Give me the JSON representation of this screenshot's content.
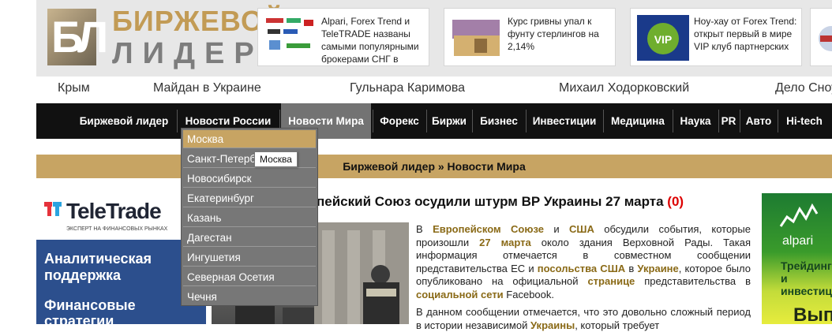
{
  "logo": {
    "line1": "БИРЖЕВОЙ",
    "line2": "ЛИДЕР",
    "mark": "БЛ"
  },
  "header_news": [
    {
      "text": "Alpari, Forex Trend и TeleTRADE названы самыми популярными брокерами СНГ в",
      "thumb_icon": "forex-brokers-thumb"
    },
    {
      "text": "Курс гривны упал к фунту стерлингов на 2,14%",
      "thumb_icon": "banknotes-thumb"
    },
    {
      "text": "Hoy-хау от Forex Trend: открыт первый в мире VIP клуб партнерских",
      "thumb_icon": "vip-badge-thumb"
    }
  ],
  "tags": [
    "Крым",
    "Майдан в Украине",
    "Гульнара Каримова",
    "Михаил Ходорковский",
    "Дело Сноудена"
  ],
  "nav": {
    "items": [
      "Биржевой лидер",
      "Новости России",
      "Новости Мира",
      "Форекс",
      "Биржи",
      "Бизнес",
      "Инвестиции",
      "Медицина",
      "Наука",
      "PR",
      "Авто",
      "Hi-tech"
    ],
    "active": "Новости Мира"
  },
  "breadcrumb": "Биржевой лидер » Новости Мира",
  "dropdown": {
    "items": [
      "Москва",
      "Санкт-Петербург",
      "Новосибирск",
      "Екатеринбург",
      "Казань",
      "Дагестан",
      "Ингушетия",
      "Северная Осетия",
      "Чечня"
    ],
    "hovered": "Москва",
    "tooltip": "Москва"
  },
  "left_ad": {
    "brand": "TeleTrade",
    "tagline": "ЭКСПЕРТ НА ФИНАНСОВЫХ РЫНКАХ",
    "line1": "Аналитическая",
    "line2": "поддержка",
    "line3": "Финансовые",
    "line4": "стратегии"
  },
  "article": {
    "title": "пейский Союз осудили штурм ВР Украины 27 марта",
    "comment_count": "(0)",
    "p1_html": "В <b>Европейском Союзе</b> и <b>США</b> обсудили события, которые произошли <b>27 марта</b> около здания Верховной Рады. Такая информация отмечается в совместном сообщении представительства ЕС и <b>посольства США</b> в <b>Украине</b>, которое было опубликовано на официальной <b>странице</b> представительства в <b>социальной сети</b> Facebook.",
    "p2_html": "В данном сообщении отмечается, что это довольно сложный период в истории независимой <b>Украины</b>, который требует"
  },
  "right_ad": {
    "brand": "alpari",
    "line1": "Трейдинг",
    "line2": "и инвестиции",
    "big": "Вып"
  },
  "colors": {
    "gold": "#c7a463",
    "nav_bg": "#111111",
    "nav_active": "#737373",
    "header_bg": "#e7e7e7",
    "title_count": "#dd0000"
  }
}
